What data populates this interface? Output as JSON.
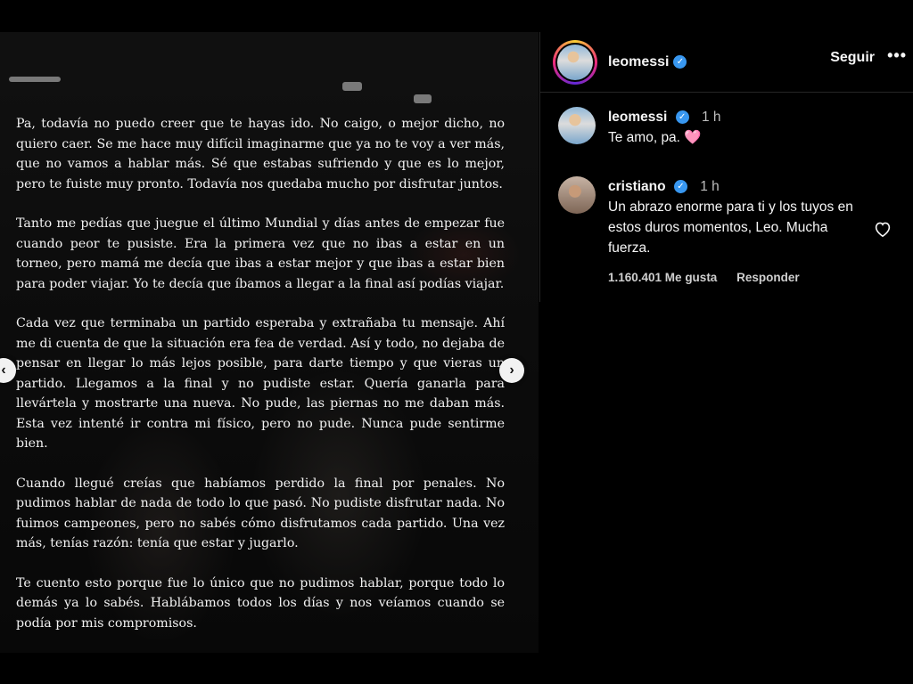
{
  "post": {
    "letter_paragraphs": [
      "Pa, todavía no puedo creer que te hayas ido. No caigo, o mejor dicho, no quiero caer. Se me hace muy difícil imaginarme que ya no te voy a ver más, que no vamos a hablar más. Sé que estabas sufriendo y que es lo mejor, pero te fuiste muy pronto. Todavía nos quedaba mucho por disfrutar juntos.",
      "Tanto me pedías que juegue el último Mundial y días antes de empezar fue cuando peor te pusiste. Era la primera vez que no ibas a estar en un torneo, pero mamá me decía que ibas a estar mejor y que ibas a estar bien para poder viajar. Yo te decía que íbamos a llegar a la final así podías viajar.",
      "Cada vez que terminaba un partido esperaba y extrañaba tu mensaje. Ahí me di cuenta de que la situación era fea de verdad. Así y todo, no dejaba de pensar en llegar lo más lejos posible, para darte tiempo y que vieras un partido. Llegamos a la final y no pudiste estar. Quería ganarla para llevártela y mostrarte una nueva. No pude, las piernas no me daban más. Esta vez intenté ir contra mi físico, pero no pude. Nunca pude sentirme bien.",
      "Cuando llegué creías que habíamos perdido la final por penales. No pudimos hablar de nada de todo lo que pasó. No pudiste disfrutar nada. No fuimos campeones, pero no sabés cómo disfrutamos cada partido. Una vez más, tenías razón: tenía que estar y jugarlo.",
      "Te cuento esto porque fue lo único que no pudimos hablar, porque todo lo demás ya lo sabés. Hablábamos todos los días y nos veíamos cuando se podía por mis compromisos."
    ],
    "nav_prev_icon": "chevron-left-icon",
    "nav_next_icon": "chevron-right-icon"
  },
  "header": {
    "username": "leomessi",
    "verified": true,
    "follow_label": "Seguir",
    "more_label": "•••"
  },
  "comments": [
    {
      "username": "leomessi",
      "verified": true,
      "time": "1 h",
      "text": "Te amo, pa.",
      "emoji": "🩷"
    },
    {
      "username": "cristiano",
      "verified": true,
      "time": "1 h",
      "text": "Un abrazo enorme para ti y los tuyos en estos duros momentos, Leo. Mucha fuerza.",
      "likes": "1.160.401 Me gusta",
      "reply_label": "Responder"
    }
  ],
  "colors": {
    "verified": "#3897f0",
    "background": "#000000",
    "divider": "#262626"
  }
}
